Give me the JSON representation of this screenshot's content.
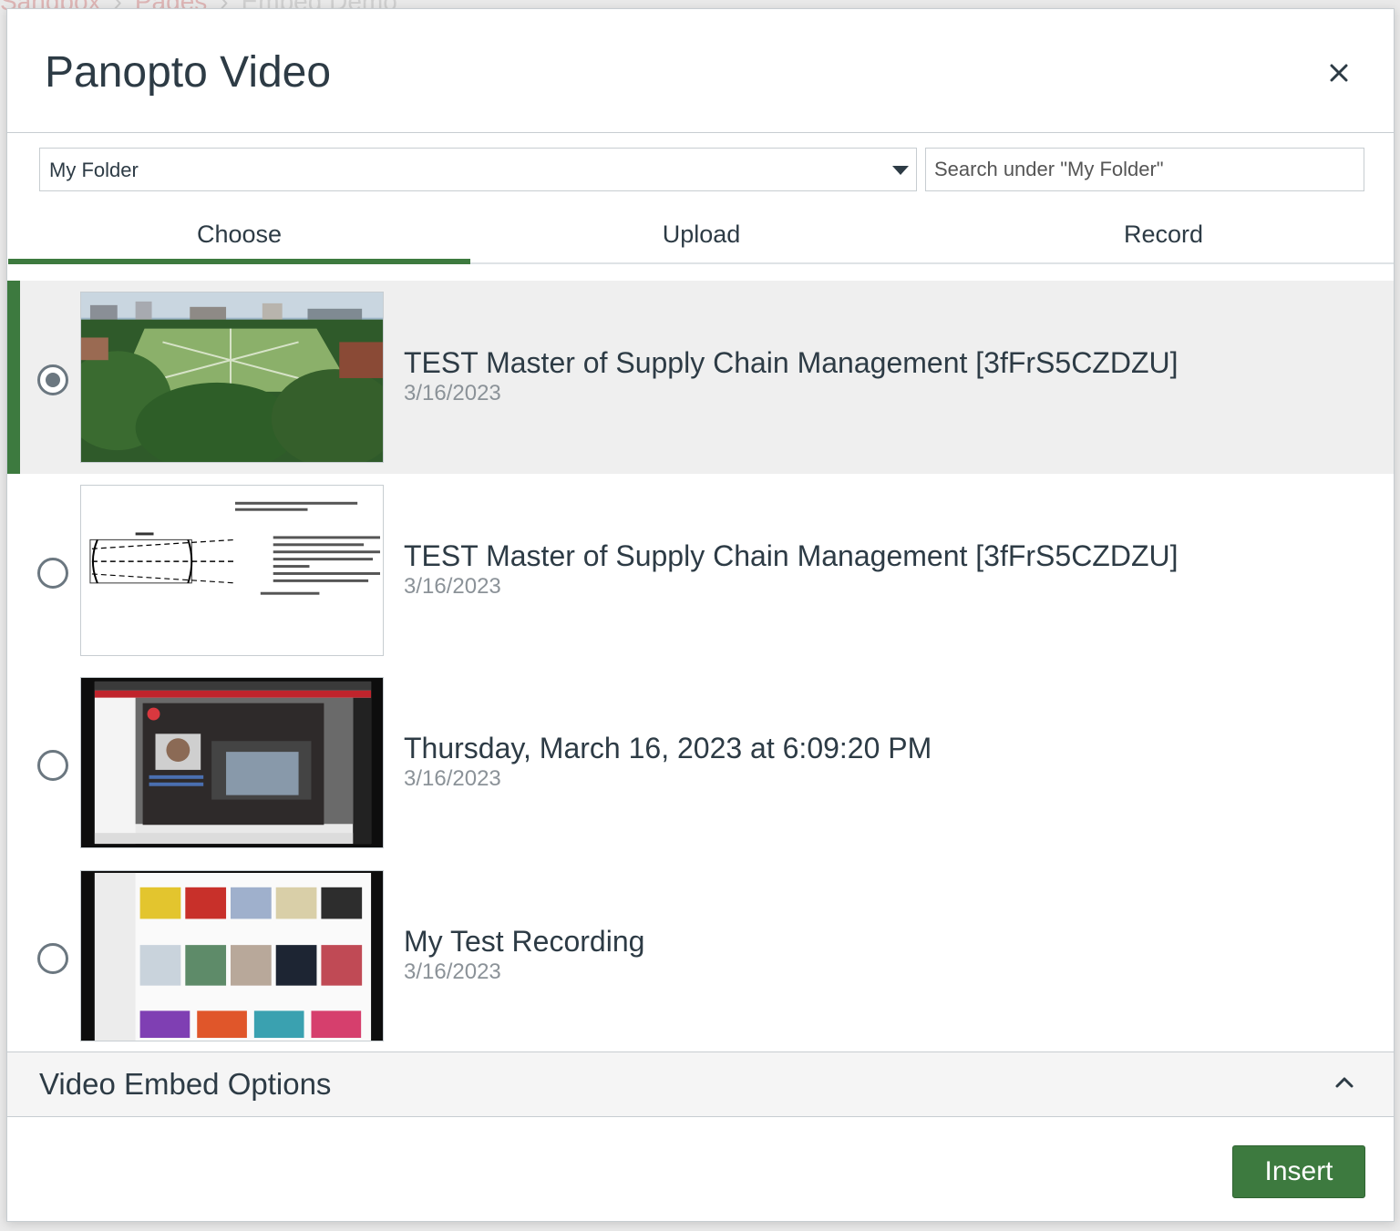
{
  "background": {
    "breadcrumb": [
      "Sandbox",
      "Pages",
      "Embed Demo"
    ]
  },
  "dialog": {
    "title": "Panopto Video",
    "close_icon": "close-icon"
  },
  "folder": {
    "selected": "My Folder",
    "search_placeholder": "Search under \"My Folder\""
  },
  "tabs": [
    {
      "label": "Choose",
      "active": true
    },
    {
      "label": "Upload",
      "active": false
    },
    {
      "label": "Record",
      "active": false
    }
  ],
  "videos": [
    {
      "title": "TEST Master of Supply Chain Management [3fFrS5CZDZU]",
      "date": "3/16/2023",
      "selected": true,
      "thumbnail": "campus-aerial-thumbnail"
    },
    {
      "title": "TEST Master of Supply Chain Management [3fFrS5CZDZU]",
      "date": "3/16/2023",
      "selected": false,
      "thumbnail": "laser-diagram-slide-thumbnail"
    },
    {
      "title": "Thursday, March 16, 2023 at 6:09:20 PM",
      "date": "3/16/2023",
      "selected": false,
      "thumbnail": "screen-recording-thumbnail"
    },
    {
      "title": "My Test Recording",
      "date": "3/16/2023",
      "selected": false,
      "thumbnail": "music-app-thumbnail"
    }
  ],
  "embed_options": {
    "label": "Video Embed Options",
    "expanded": true
  },
  "insert_label": "Insert",
  "colors": {
    "accent": "#3d7a3f",
    "text": "#2d3b45",
    "muted": "#8b9298",
    "border": "#c7cdd1"
  }
}
